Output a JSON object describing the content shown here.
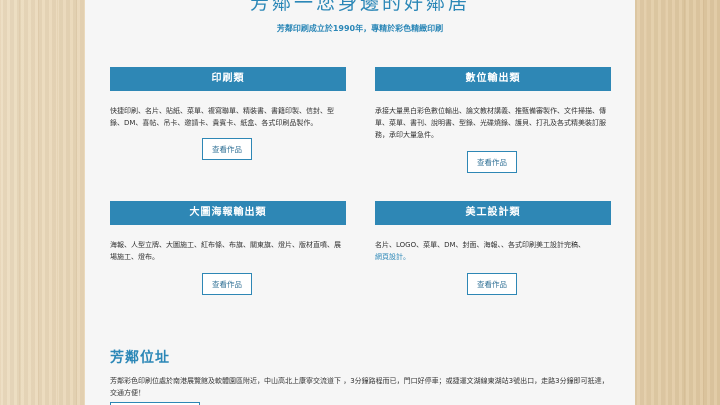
{
  "header": {
    "title": "芳鄰一您身邊的好鄰居",
    "intro": "芳鄰印刷成立於1990年，專精於彩色精緻印刷"
  },
  "cards": [
    {
      "title": "印刷類",
      "desc": "快捷印刷、名片、貼紙、菜單、複寫聯單、精裝書、書籍印製、信封、型錄、DM、喜帖、吊卡、邀請卡、貴賓卡、紙盒、各式印刷品製作。",
      "button": "查看作品"
    },
    {
      "title": "數位輸出類",
      "desc": "承接大量黑白彩色數位輸出、論文教材講義、推甄備審製作、文件掃描、傳單、菜單、書刊、說明書、型錄、光碟燒錄、護貝、打孔及各式精美裝訂服務，承印大量急件。",
      "button": "查看作品"
    },
    {
      "title": "大圖海報輸出類",
      "desc": "海報、人型立牌、大圖施工、紅布條、布旗、關東旗、燈片、版材直噴、展場施工、燈布。",
      "button": "查看作品"
    },
    {
      "title": "美工設計類",
      "desc": "名片、LOGO、菜單、DM、封面、海報、、各式印刷美工設計完稿、",
      "link": "網頁設計。",
      "button": "查看作品"
    }
  ],
  "location": {
    "title": "芳鄰位址",
    "text": "芳鄰彩色印刷位處於南港展覽館及軟體園區附近，中山高北上康寧交流道下 ，3分鐘路程而已，門口好停車；或捷運文湖線東湖站3號出口，走路3分鐘即可抵達，交通方便！"
  }
}
